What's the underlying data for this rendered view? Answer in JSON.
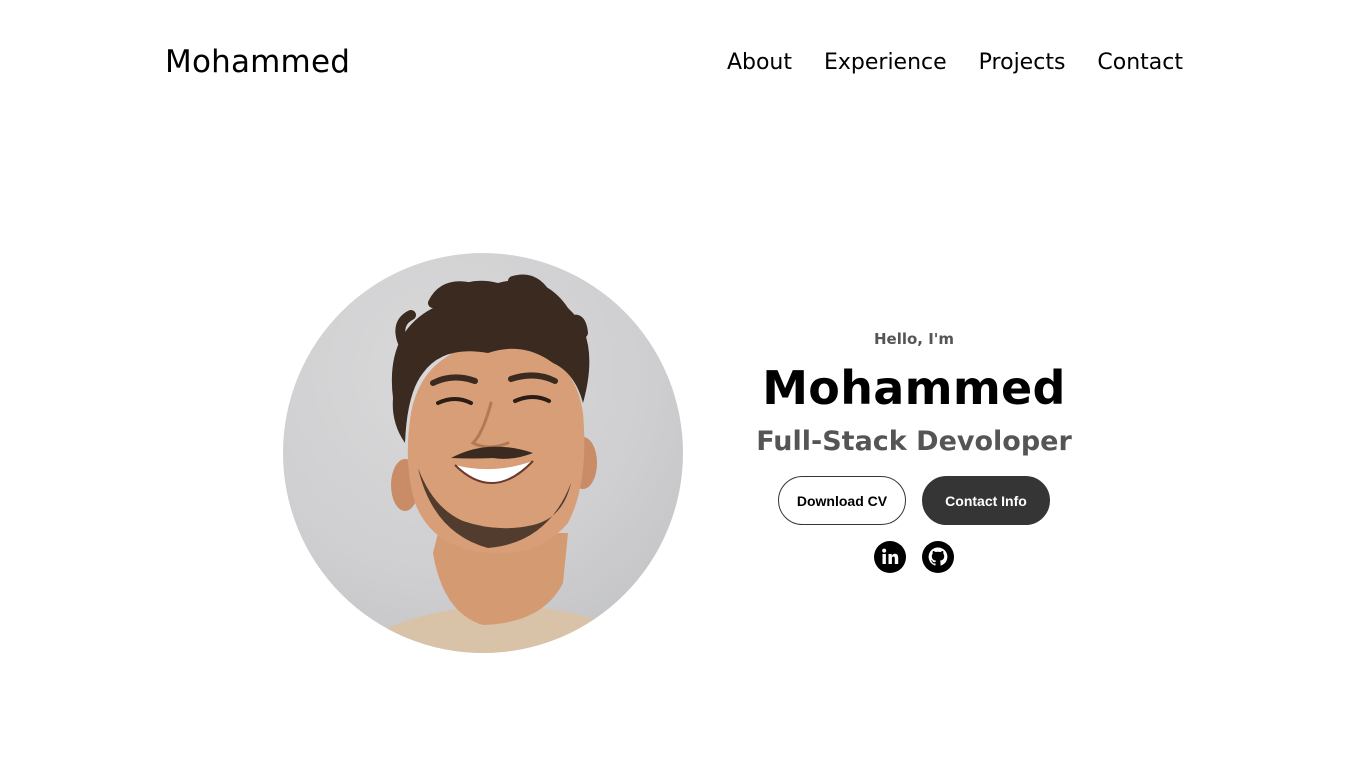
{
  "nav": {
    "logo": "Mohammed",
    "links": [
      {
        "label": "About"
      },
      {
        "label": "Experience"
      },
      {
        "label": "Projects"
      },
      {
        "label": "Contact"
      }
    ]
  },
  "hero": {
    "greeting": "Hello, I'm",
    "name": "Mohammed",
    "title": "Full-Stack Devoloper",
    "buttons": {
      "download_cv": "Download CV",
      "contact_info": "Contact Info"
    },
    "photo_icon": "profile-photo",
    "socials": [
      {
        "icon": "linkedin-icon"
      },
      {
        "icon": "github-icon"
      }
    ]
  },
  "colors": {
    "text_primary": "#000000",
    "text_secondary": "#555555",
    "button_dark": "#353535",
    "background": "#ffffff"
  }
}
